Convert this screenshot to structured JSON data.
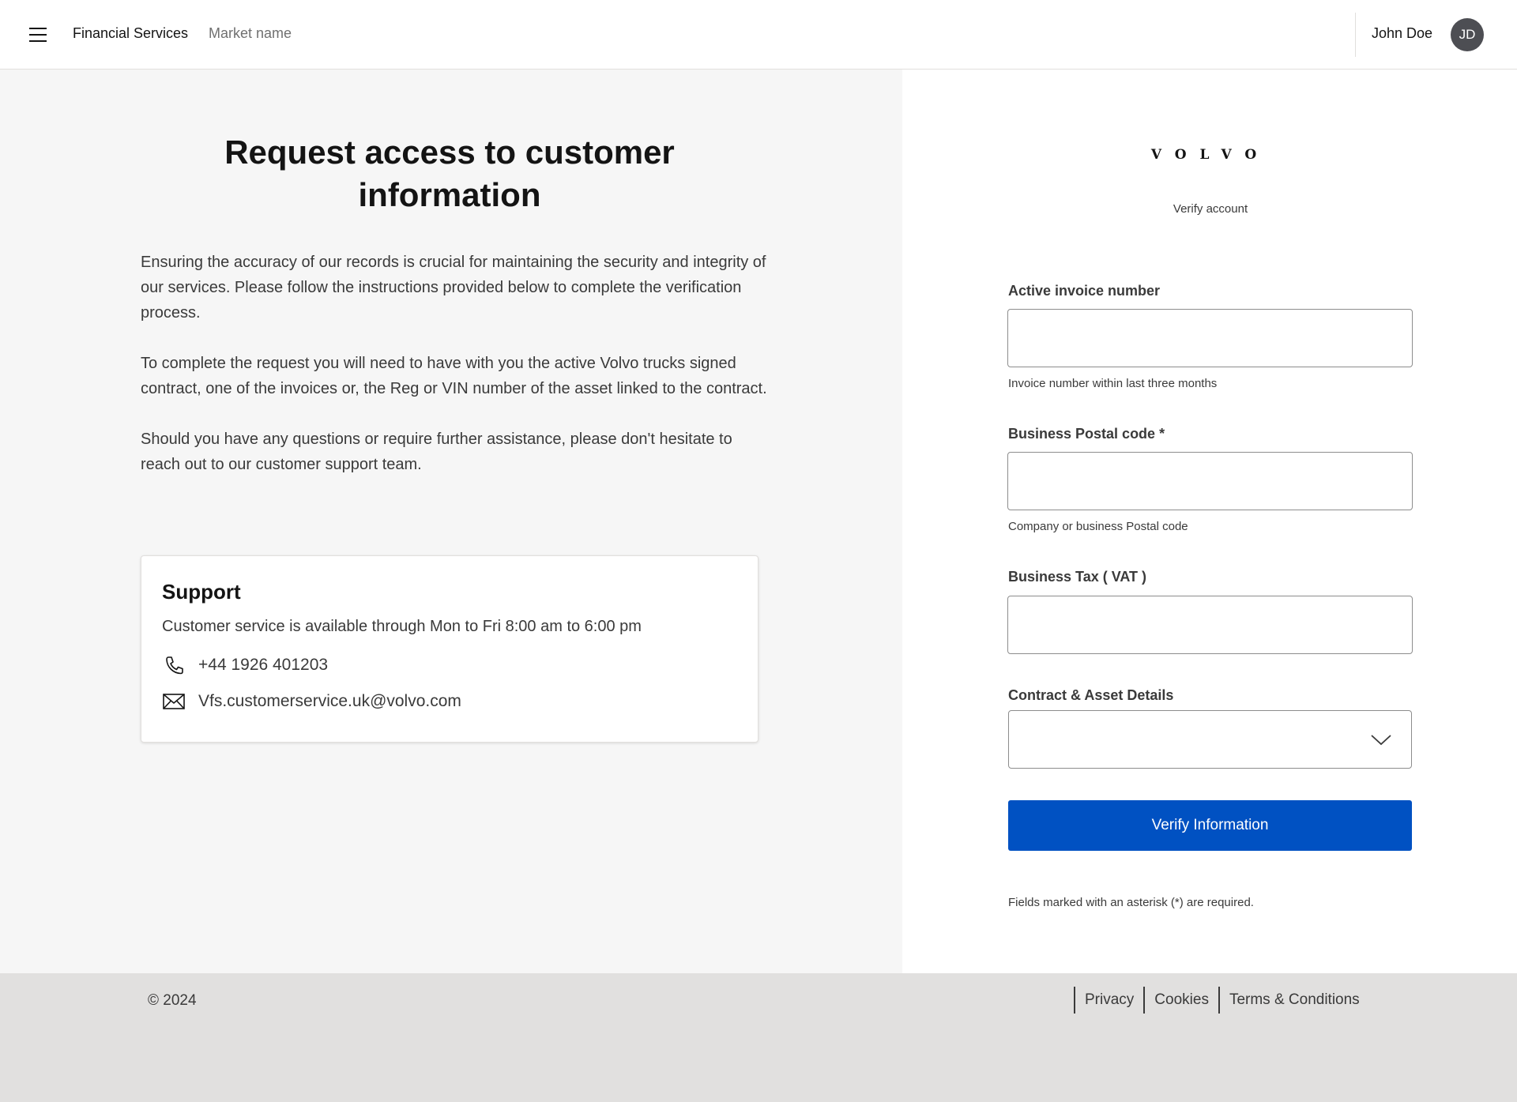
{
  "header": {
    "brand": "Financial Services",
    "market": "Market name",
    "user_name": "John Doe",
    "avatar_initials": "JD"
  },
  "main": {
    "title": "Request access to customer information",
    "paragraphs": [
      "Ensuring the accuracy of our records is crucial for maintaining the security and integrity of our services. Please follow the instructions provided below to complete the verification process.",
      "To complete the request you will need to have with you the active Volvo  trucks signed contract, one of the invoices or, the Reg or VIN number of the asset linked to the contract.",
      "Should you have any questions or require further assistance, please don't hesitate to reach out to our customer support team."
    ],
    "support": {
      "title": "Support",
      "hours": "Customer service is available through Mon to Fri 8:00 am to 6:00 pm",
      "phone": "+44 1926 401203",
      "email": "Vfs.customerservice.uk@volvo.com"
    }
  },
  "form": {
    "logo": "VOLVO",
    "subtitle": "Verify account",
    "invoice_label": "Active invoice number",
    "invoice_value": "",
    "invoice_help": "Invoice number within last three months",
    "postal_label": "Business Postal code *",
    "postal_value": "",
    "postal_help": "Company or business Postal code",
    "tax_label": "Business Tax ( VAT )",
    "tax_value": "",
    "contract_label": "Contract & Asset Details",
    "contract_selected": "",
    "submit_label": "Verify Information",
    "required_note": "Fields marked with an asterisk (*) are required."
  },
  "footer": {
    "copyright": "© 2024",
    "links": [
      "Privacy",
      "Cookies",
      "Terms & Conditions"
    ]
  },
  "colors": {
    "primary_button": "#0051c2",
    "left_panel_bg": "#f6f6f6",
    "footer_bg": "#e1e0df"
  }
}
